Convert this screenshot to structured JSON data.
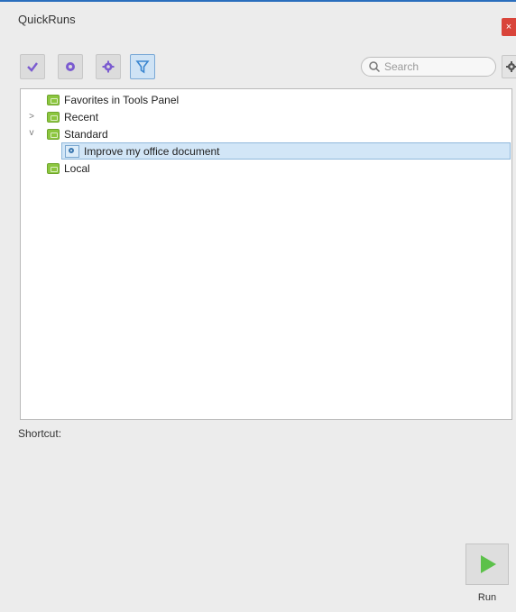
{
  "window": {
    "title": "QuickRuns",
    "close_glyph": "×"
  },
  "toolbar": {
    "buttons": [
      {
        "name": "checkmark-icon",
        "color": "#7b5bd0"
      },
      {
        "name": "circle-icon",
        "color": "#7b5bd0"
      },
      {
        "name": "gear-icon",
        "color": "#7b5bd0"
      },
      {
        "name": "filter-icon",
        "color": "#3a86d0",
        "active": true
      }
    ],
    "search_placeholder": "Search",
    "options_icon": "gear-dropdown-icon"
  },
  "tree": {
    "items": [
      {
        "label": "Favorites in Tools Panel",
        "icon": "folder-icon",
        "expander": ""
      },
      {
        "label": "Recent",
        "icon": "folder-icon",
        "expander": ">"
      },
      {
        "label": "Standard",
        "icon": "folder-icon",
        "expander": "v"
      },
      {
        "label": "Improve my office document",
        "icon": "document-icon",
        "selected": true
      },
      {
        "label": "Local",
        "icon": "folder-icon",
        "expander": ""
      }
    ]
  },
  "shortcut": {
    "label": "Shortcut:"
  },
  "run": {
    "label": "Run",
    "accent": "#5cc14a"
  }
}
